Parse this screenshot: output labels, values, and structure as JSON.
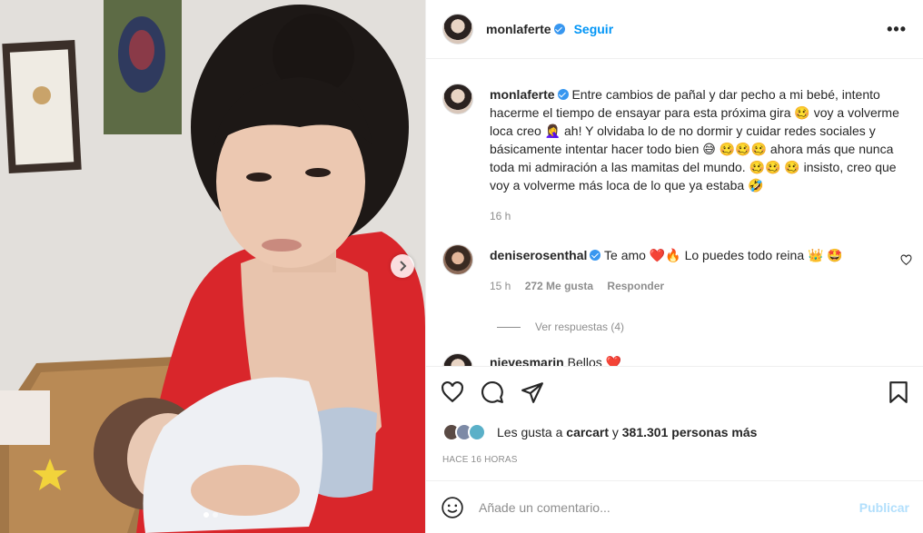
{
  "post": {
    "author": "monlaferte",
    "follow_label": "Seguir",
    "more_label": "•••",
    "photo_dots": 2,
    "active_dot": 0
  },
  "caption": {
    "username": "monlaferte",
    "text": "Entre cambios de pañal y dar pecho a mi bebé, intento hacerme el tiempo de ensayar para esta próxima gira 🥴 voy a volverme loca creo 🤦‍♀️ ah! Y olvidaba lo de no dormir y cuidar redes sociales y básicamente intentar hacer todo bien 😅 🥴🥴🥴 ahora más que nunca toda mi admiración a las mamitas del mundo. 🥴🥴 🥴 insisto, creo que voy a volverme más loca de lo que ya estaba 🤣",
    "time": "16 h"
  },
  "comments": [
    {
      "username": "deniserosenthal",
      "text": "Te amo ❤️🔥 Lo puedes todo reina 👑 🤩",
      "time": "15 h",
      "likes": "272 Me gusta",
      "reply_label": "Responder",
      "view_replies": "Ver respuestas (4)"
    },
    {
      "username": "nievesmarin",
      "text": "Bellos ❤️"
    }
  ],
  "likes": {
    "prefix": "Les gusta a",
    "user": "carcart",
    "middle": "y",
    "count": "381.301 personas más"
  },
  "timestamp": "HACE 16 HORAS",
  "add_comment": {
    "placeholder": "Añade un comentario...",
    "publish_label": "Publicar"
  },
  "colors": {
    "accent": "#0095f6",
    "verified": "#3897f0",
    "publish_disabled": "#b2dffc",
    "muted": "#8e8e8e"
  }
}
